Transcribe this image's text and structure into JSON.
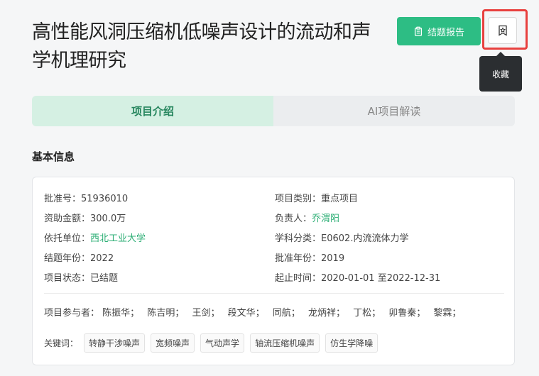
{
  "project": {
    "title": "高性能风洞压缩机低噪声设计的流动和声学机理研究"
  },
  "actions": {
    "report_label": "结题报告",
    "favorite_tooltip": "收藏"
  },
  "tabs": [
    {
      "label": "项目介绍",
      "active": true
    },
    {
      "label": "AI项目解读",
      "active": false
    }
  ],
  "basic_info": {
    "section_title": "基本信息",
    "rows": [
      [
        {
          "label": "批准号：",
          "value": "51936010"
        },
        {
          "label": "项目类别：",
          "value": "重点项目"
        }
      ],
      [
        {
          "label": "资助金额：",
          "value": "300.0万"
        },
        {
          "label": "负责人：",
          "value": "乔渭阳"
        }
      ],
      [
        {
          "label": "依托单位：",
          "value": "西北工业大学"
        },
        {
          "label": "学科分类：",
          "value": "E0602.内流流体力学"
        }
      ],
      [
        {
          "label": "结题年份：",
          "value": "2022"
        },
        {
          "label": "批准年份：",
          "value": "2019"
        }
      ],
      [
        {
          "label": "项目状态：",
          "value": "已结题"
        },
        {
          "label": "起止时间：",
          "value": "2020-01-01 至2022-12-31"
        }
      ]
    ],
    "participants_label": "项目参与者：",
    "participants": [
      "陈振华；",
      "陈吉明；",
      "王剑；",
      "段文华；",
      "同航；",
      "龙炳祥；",
      "丁松；",
      "卯鲁秦；",
      "黎霖；"
    ],
    "keywords_label": "关键词：",
    "keywords": [
      "转静干涉噪声",
      "宽频噪声",
      "气动声学",
      "轴流压缩机噪声",
      "仿生学降噪"
    ]
  },
  "colors": {
    "accent_green": "#2dbd84",
    "link_green": "#2bae74",
    "highlight_red": "#e8403e"
  }
}
